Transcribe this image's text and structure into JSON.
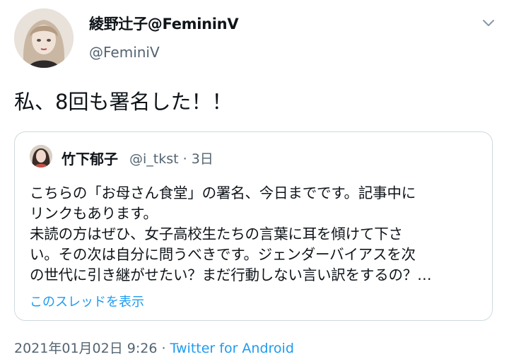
{
  "author": {
    "display_name": "綾野辻子@FemininV",
    "handle": "@FeminiV"
  },
  "tweet": {
    "text": "私、8回も署名した！！"
  },
  "quoted_tweet": {
    "display_name": "竹下郁子",
    "meta": "@i_tkst · 3日",
    "lines": [
      "こちらの「お母さん食堂」の署名、今日までです。記事中に",
      "リンクもあります。",
      "未読の方はぜひ、女子高校生たちの言葉に耳を傾けて下さ",
      "い。その次は自分に問うべきです。ジェンダーバイアスを次",
      "の世代に引き継がせたい？まだ行動しない言い訳をするの？…"
    ],
    "show_thread_label": "このスレッドを表示"
  },
  "footer": {
    "timestamp": "2021年01月02日 9:26",
    "separator": " · ",
    "source": "Twitter for Android"
  },
  "icons": {
    "menu": "chevron-down-icon"
  },
  "colors": {
    "link": "#1d9bf0",
    "secondary_text": "#536471",
    "border": "#cfd9de"
  }
}
